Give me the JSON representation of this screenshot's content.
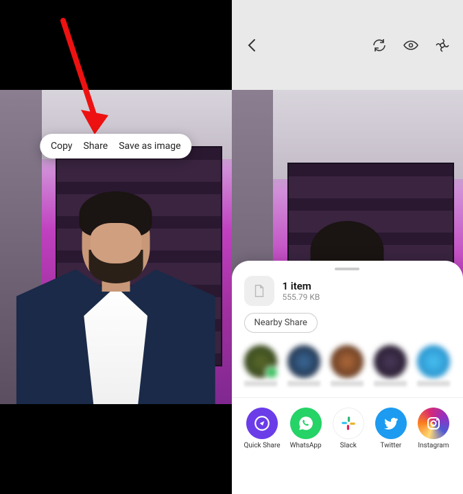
{
  "left": {
    "context_menu": {
      "copy": "Copy",
      "share": "Share",
      "save_as_image": "Save as image"
    }
  },
  "right": {
    "sheet": {
      "title": "1 item",
      "size": "555.79 KB",
      "nearby": "Nearby Share"
    },
    "apps": {
      "quick_share": "Quick Share",
      "whatsapp": "WhatsApp",
      "slack": "Slack",
      "twitter": "Twitter",
      "instagram": "Instagram"
    }
  }
}
